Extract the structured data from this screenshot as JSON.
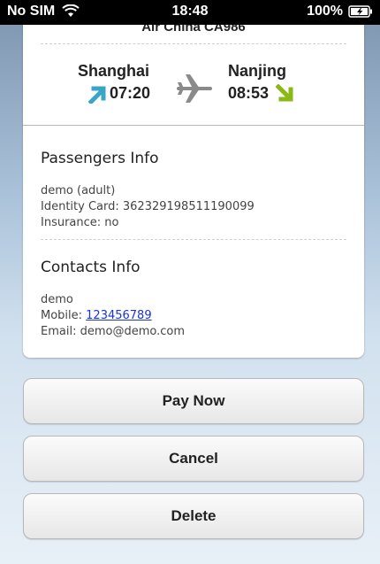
{
  "status_bar": {
    "carrier": "No SIM",
    "time": "18:48",
    "battery": "100%"
  },
  "flight": {
    "title": "Air China CA986",
    "departure": {
      "city": "Shanghai",
      "time": "07:20"
    },
    "arrival": {
      "city": "Nanjing",
      "time": "08:53"
    }
  },
  "passengers": {
    "title": "Passengers Info",
    "name": "demo (adult)",
    "identity": "Identity Card: 362329198511190099",
    "insurance": "Insurance: no"
  },
  "contacts": {
    "title": "Contacts Info",
    "name": "demo",
    "mobile_label": "Mobile: ",
    "mobile_number": "123456789",
    "email": "Email: demo@demo.com"
  },
  "buttons": {
    "pay": "Pay Now",
    "cancel": "Cancel",
    "delete": "Delete"
  },
  "icons": {
    "departure": "departure-arrow-icon",
    "arrival": "arrival-arrow-icon",
    "plane": "airplane-icon"
  },
  "colors": {
    "departure_arrow": "#3aa6c7",
    "arrival_arrow": "#8ab814",
    "link": "#1a33d6"
  }
}
